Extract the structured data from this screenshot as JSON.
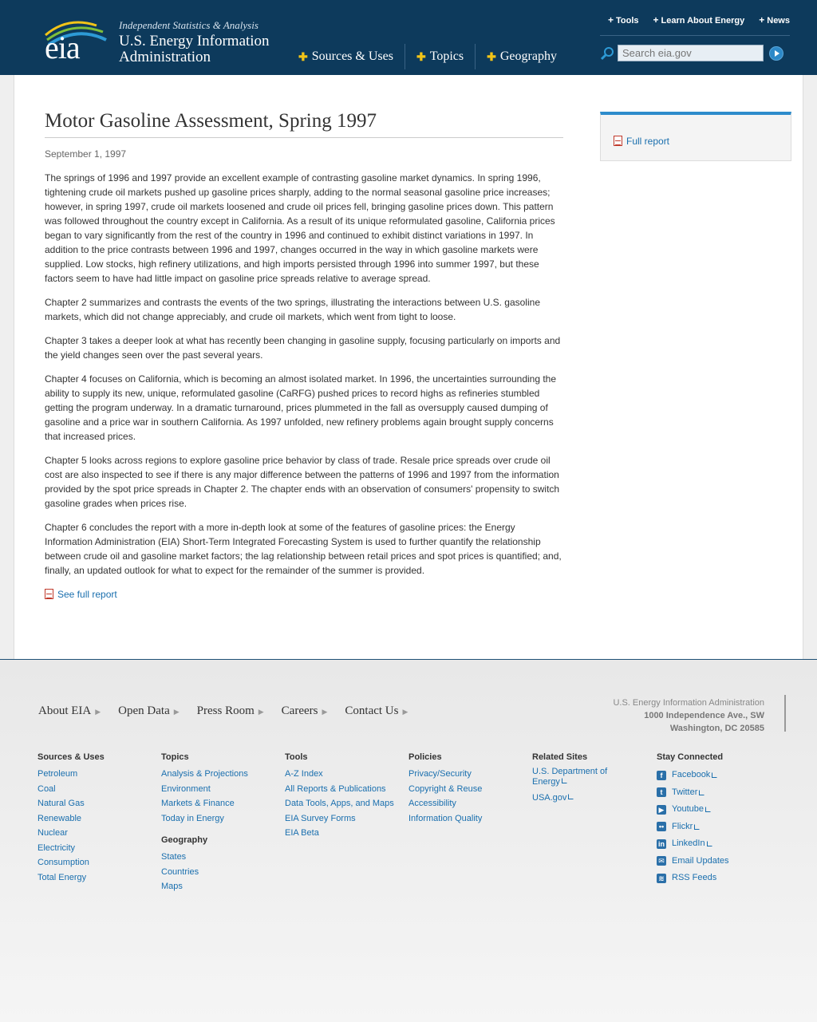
{
  "header": {
    "logo_text": "eia",
    "tagline": "Independent Statistics & Analysis",
    "org_line1": "U.S. Energy Information",
    "org_line2": "Administration",
    "main_nav": [
      "Sources & Uses",
      "Topics",
      "Geography"
    ],
    "top_nav": [
      "Tools",
      "Learn About Energy",
      "News"
    ],
    "search_placeholder": "Search eia.gov"
  },
  "article": {
    "title": "Motor Gasoline Assessment, Spring 1997",
    "date": "September 1, 1997",
    "paragraphs": [
      "The springs of 1996 and 1997 provide an excellent example of contrasting gasoline market dynamics. In spring 1996, tightening crude oil markets pushed up gasoline prices sharply, adding to the normal seasonal gasoline price increases; however, in spring 1997, crude oil markets loosened and crude oil prices fell, bringing gasoline prices down. This pattern was followed throughout the country except in California. As a result of its unique reformulated gasoline, California prices began to vary significantly from the rest of the country in 1996 and continued to exhibit distinct variations in 1997. In addition to the price contrasts between 1996 and 1997, changes occurred in the way in which gasoline markets were supplied. Low stocks, high refinery utilizations, and high imports persisted through 1996 into summer 1997, but these factors seem to have had little impact on gasoline price spreads relative to average spread.",
      "Chapter 2 summarizes and contrasts the events of the two springs, illustrating the interactions between U.S. gasoline markets, which did not change appreciably, and crude oil markets, which went from tight to loose.",
      "Chapter 3 takes a deeper look at what has recently been changing in gasoline supply, focusing particularly on imports and the yield changes seen over the past several years.",
      "Chapter 4 focuses on California, which is becoming an almost isolated market. In 1996, the uncertainties surrounding the ability to supply its new, unique, reformulated gasoline (CaRFG) pushed prices to record highs as refineries stumbled getting the program underway. In a dramatic turnaround, prices plummeted in the fall as oversupply caused dumping of gasoline and a price war in southern California. As 1997 unfolded, new refinery problems again brought supply concerns that increased prices.",
      "Chapter 5 looks across regions to explore gasoline price behavior by class of trade. Resale price spreads over crude oil cost are also inspected to see if there is any major difference between the patterns of 1996 and 1997 from the information provided by the spot price spreads in Chapter 2. The chapter ends with an observation of consumers' propensity to switch gasoline grades when prices rise.",
      "Chapter 6 concludes the report with a more in-depth look at some of the features of gasoline prices: the Energy Information Administration (EIA) Short-Term Integrated Forecasting System is used to further quantify the relationship between crude oil and gasoline market factors; the lag relationship between retail prices and spot prices is quantified; and, finally, an updated outlook for what to expect for the remainder of the summer is provided."
    ],
    "see_full_report": "See full report"
  },
  "sidebar": {
    "full_report": "Full report"
  },
  "footer": {
    "nav": [
      "About EIA",
      "Open Data",
      "Press Room",
      "Careers",
      "Contact Us"
    ],
    "address": [
      "U.S. Energy Information Administration",
      "1000 Independence Ave., SW",
      "Washington, DC 20585"
    ],
    "sources_uses": {
      "heading": "Sources & Uses",
      "links": [
        "Petroleum",
        "Coal",
        "Natural Gas",
        "Renewable",
        "Nuclear",
        "Electricity",
        "Consumption",
        "Total Energy"
      ]
    },
    "topics": {
      "heading": "Topics",
      "links": [
        "Analysis & Projections",
        "Environment",
        "Markets & Finance",
        "Today in Energy"
      ]
    },
    "geography": {
      "heading": "Geography",
      "links": [
        "States",
        "Countries",
        "Maps"
      ]
    },
    "tools": {
      "heading": "Tools",
      "links": [
        "A-Z Index",
        "All Reports & Publications",
        "Data Tools, Apps, and Maps",
        "EIA Survey Forms",
        "EIA Beta"
      ]
    },
    "policies": {
      "heading": "Policies",
      "links": [
        "Privacy/Security",
        "Copyright & Reuse",
        "Accessibility",
        "Information Quality"
      ]
    },
    "related": {
      "heading": "Related Sites",
      "links": [
        "U.S. Department of Energy",
        "USA.gov"
      ]
    },
    "stay": {
      "heading": "Stay Connected",
      "links": [
        "Facebook",
        "Twitter",
        "Youtube",
        "Flickr",
        "LinkedIn",
        "Email Updates",
        "RSS Feeds"
      ]
    }
  }
}
